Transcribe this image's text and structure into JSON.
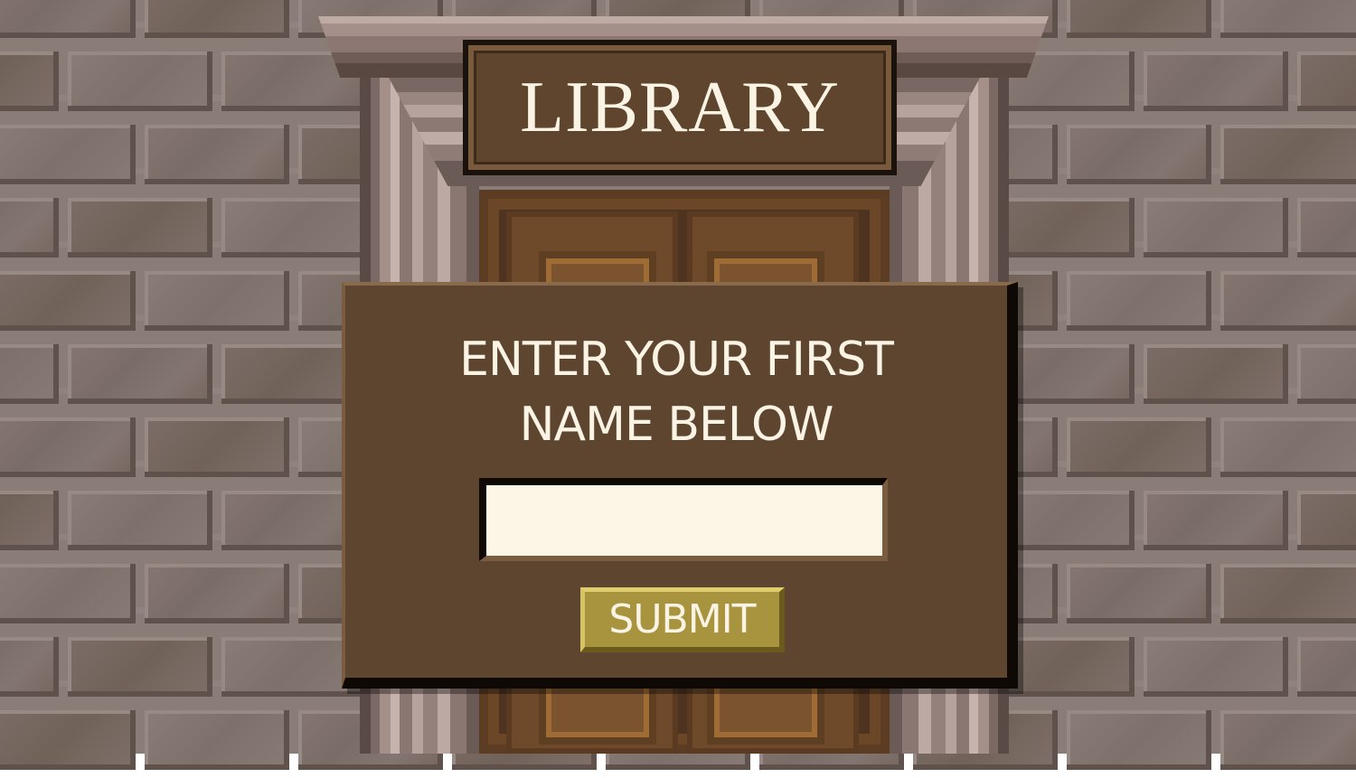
{
  "sign": {
    "title": "LIBRARY"
  },
  "form": {
    "prompt_line1": "ENTER YOUR FIRST",
    "prompt_line2": "NAME BELOW",
    "name_value": "",
    "submit_label": "SUBMIT"
  },
  "colors": {
    "brick": "#7a6c66",
    "mortar": "#8f8380",
    "panel": "#5e4530",
    "sign": "#5f452d",
    "text": "#fbf4e4",
    "input_bg": "#fdf6e6",
    "button": "#a8943e"
  }
}
